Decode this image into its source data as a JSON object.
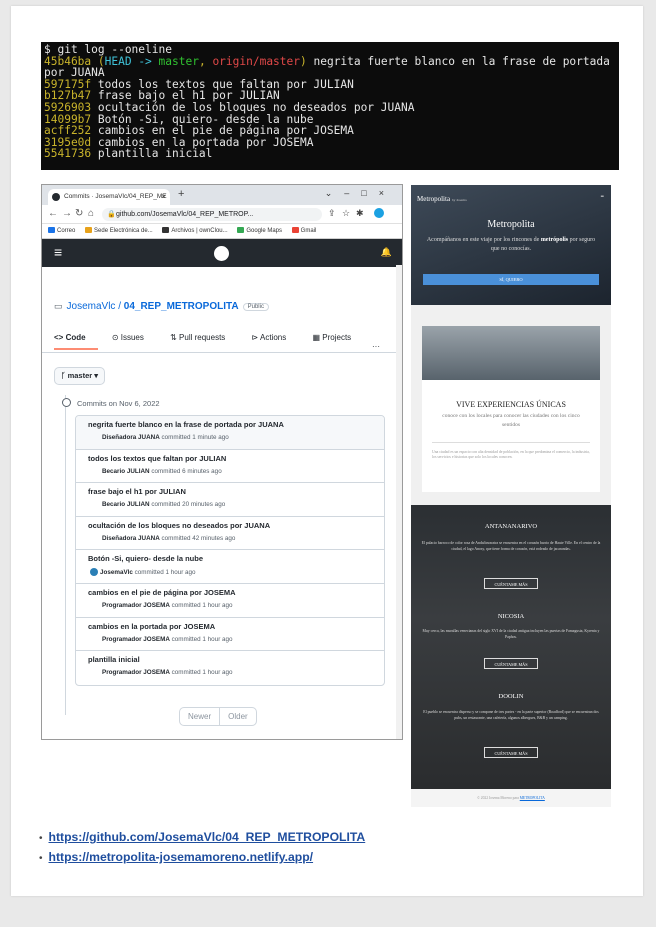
{
  "terminal": {
    "prompt": "$ git log --oneline",
    "head_hash": "45b46ba",
    "head_open": " (",
    "head_label": "HEAD -> ",
    "head_branch": "master",
    "head_comma": ", ",
    "head_remote": "origin/master",
    "head_close": ")",
    "head_msg": " negrita fuerte blanco en la frase de portada por JUANA",
    "lines": [
      {
        "hash": "597175f",
        "msg": " todos los textos que faltan por JULIAN"
      },
      {
        "hash": "b127b47",
        "msg": " frase bajo el h1 por JULIAN"
      },
      {
        "hash": "5926903",
        "msg": " ocultación de los bloques no deseados por JUANA"
      },
      {
        "hash": "14099b7",
        "msg": " Botón -Si, quiero- desde la nube"
      },
      {
        "hash": "acff252",
        "msg": " cambios en el pie de página por JOSEMA"
      },
      {
        "hash": "3195e0d",
        "msg": " cambios en la portada por JOSEMA"
      },
      {
        "hash": "5541736",
        "msg": " plantilla inicial"
      }
    ]
  },
  "browser": {
    "tab_title": "Commits · JosemaVlc/04_REP_ME",
    "url": "github.com/JosemaVlc/04_REP_METROP...",
    "bookmarks": [
      {
        "label": "Correo",
        "color": "#1a73e8"
      },
      {
        "label": "Sede Electrónica de...",
        "color": "#e8a21a"
      },
      {
        "label": "Archivos | ownClou...",
        "color": "#333333"
      },
      {
        "label": "Google Maps",
        "color": "#34a853"
      },
      {
        "label": "Gmail",
        "color": "#ea4335"
      }
    ],
    "repo_owner": "JosemaVlc",
    "repo_sep": " / ",
    "repo_name": "04_REP_METROPOLITA",
    "repo_visibility": "Public",
    "tabs": [
      "Code",
      "Issues",
      "Pull requests",
      "Actions",
      "Projects"
    ],
    "more": "···",
    "branch": "master",
    "commits_on": "Commits on Nov 6, 2022",
    "commits": [
      {
        "msg": "negrita fuerte blanco en la frase de portada por JUANA",
        "author": "Diseñadora JUANA",
        "when": " committed 1 minute ago"
      },
      {
        "msg": "todos los textos que faltan por JULIAN",
        "author": "Becario JULIAN",
        "when": " committed 6 minutes ago"
      },
      {
        "msg": "frase bajo el h1 por JULIAN",
        "author": "Becario JULIAN",
        "when": " committed 20 minutes ago"
      },
      {
        "msg": "ocultación de los bloques no deseados por JUANA",
        "author": "Diseñadora JUANA",
        "when": " committed 42 minutes ago"
      },
      {
        "msg": "Botón -Si, quiero- desde la nube",
        "author": "JosemaVlc",
        "when": " committed 1 hour ago"
      },
      {
        "msg": "cambios en el pie de página por JOSEMA",
        "author": "Programador JOSEMA",
        "when": " committed 1 hour ago"
      },
      {
        "msg": "cambios en la portada por JOSEMA",
        "author": "Programador JOSEMA",
        "when": " committed 1 hour ago"
      },
      {
        "msg": "plantilla inicial",
        "author": "Programador JOSEMA",
        "when": " committed 1 hour ago"
      }
    ],
    "pager": {
      "newer": "Newer",
      "older": "Older"
    }
  },
  "mobile": {
    "brand": "Metropolita",
    "brand_small": "by Josema",
    "hero_title": "Metropolita",
    "hero_sub_a": "Acompáñanos en este viaje por los rincones de ",
    "hero_sub_b": "metrópolis",
    "hero_sub_c": " por seguro que no conocías.",
    "hero_button": "SÍ, QUIERO",
    "card_title": "VIVE EXPERIENCIAS ÚNICAS",
    "card_sub": "conoce con los locales para conocer las ciudades con los cinco sentidos",
    "card_body": "Una ciudad es un espacio con alta densidad de población, en la que predomina el comercio, la industria, los servicios e historias que solo los locales conocen.",
    "cities": [
      {
        "name": "ANTANANARIVO",
        "desc": "El palacio barroco de color rosa de Andafiavaratra se encuentra en el corazón barrio de Haute Ville. En el centro de la ciudad, el lago Anosy, que tiene forma de corazón, está rodeado de jacarandas.",
        "button": "CUÉNTAME MÁS"
      },
      {
        "name": "NICOSIA",
        "desc": "Muy cerca, las murallas venecianas del siglo XVI de la ciudad antigua incluyen las puertas de Famagusta, Kyrenia y Paphos.",
        "button": "CUÉNTAME MÁS"
      },
      {
        "name": "DOOLIN",
        "desc": "El pueblo se encuentra disperso y se compone de tres partes - en la parte superior (Roadford) que se encuentran dos pubs, un restaurante, una cafetería, algunos albergues, B&B y un camping.",
        "button": "CUÉNTAME MÁS"
      }
    ],
    "footer_a": "© 2022 Josema Moreno para ",
    "footer_link": "METROPOLITA"
  },
  "links": [
    "https://github.com/JosemaVlc/04_REP_METROPOLITA",
    "https://metropolita-josemamoreno.netlify.app/"
  ]
}
